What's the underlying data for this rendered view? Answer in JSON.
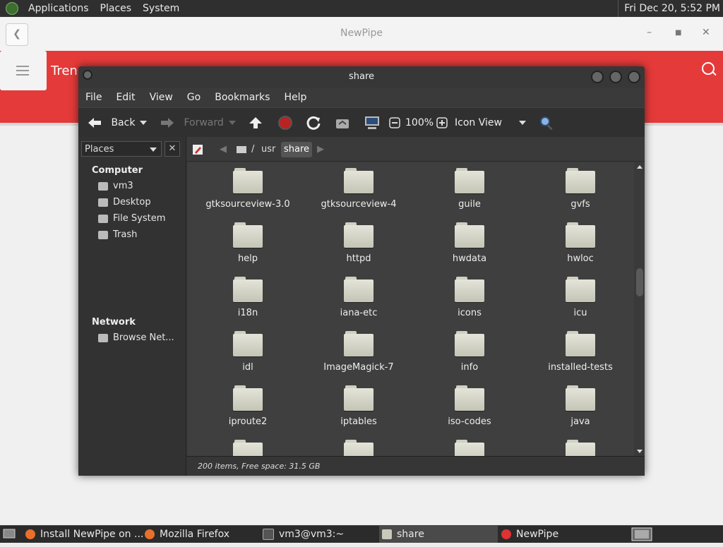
{
  "top_panel": {
    "menus": [
      "Applications",
      "Places",
      "System"
    ],
    "clock": "Fri Dec 20,  5:52 PM"
  },
  "newpipe": {
    "window_title": "NewPipe",
    "tab_label": "Tren",
    "accent_color": "#e53a3a"
  },
  "file_manager": {
    "title": "share",
    "menu": [
      "File",
      "Edit",
      "View",
      "Go",
      "Bookmarks",
      "Help"
    ],
    "toolbar": {
      "back": "Back",
      "forward": "Forward",
      "zoom": "100%",
      "view_mode": "Icon View"
    },
    "sidebar": {
      "combo": "Places",
      "computer_header": "Computer",
      "computer_items": [
        "vm3",
        "Desktop",
        "File System",
        "Trash"
      ],
      "network_header": "Network",
      "network_items": [
        "Browse Net..."
      ]
    },
    "path": [
      "/",
      "usr",
      "share"
    ],
    "folders": [
      "gtksourceview-3.0",
      "gtksourceview-4",
      "guile",
      "gvfs",
      "help",
      "httpd",
      "hwdata",
      "hwloc",
      "i18n",
      "iana-etc",
      "icons",
      "icu",
      "idl",
      "ImageMagick-7",
      "info",
      "installed-tests",
      "iproute2",
      "iptables",
      "iso-codes",
      "java"
    ],
    "status": "200 items, Free space: 31.5 GB"
  },
  "taskbar": {
    "tasks": [
      {
        "label": "Install NewPipe on ...",
        "icon": "firefox-icon"
      },
      {
        "label": "Mozilla Firefox",
        "icon": "firefox-icon"
      },
      {
        "label": "vm3@vm3:~",
        "icon": "terminal-icon"
      },
      {
        "label": "share",
        "icon": "folder-icon"
      },
      {
        "label": "NewPipe",
        "icon": "newpipe-icon"
      }
    ]
  }
}
